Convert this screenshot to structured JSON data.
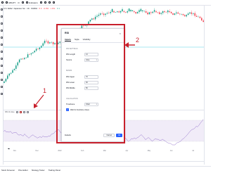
{
  "topbar": {
    "symbol": "GBUPY",
    "interval": "D",
    "indicators_label": "Indicators",
    "icons": [
      "menu-icon",
      "search-icon",
      "chart-type-icon",
      "indicators-icon",
      "alert-icon",
      "replay-icon",
      "undo-icon",
      "redo-icon"
    ]
  },
  "secondbar": {
    "title": "U.S. Dollar / Japanese Yen · 1D · OANDA",
    "o": "O 0.",
    "h": "H 152.",
    "l": "L 151.",
    "c": "C 1"
  },
  "oscillator": {
    "label": "RSI 14 close"
  },
  "time_axis": [
    "Nov",
    "Dec",
    "2022",
    "Feb",
    "Mar",
    "Apr",
    "May",
    "Jun",
    "Jul"
  ],
  "bottom_tabs": [
    "Stock Screener",
    "Pine Editor",
    "Strategy Tester",
    "Trading Panel"
  ],
  "dialog": {
    "title": "RSI",
    "close": "×",
    "tabs": [
      "Inputs",
      "Style",
      "Visibility"
    ],
    "section1": "RSI SETTINGS",
    "rows1": [
      {
        "label": "RSI Length",
        "value": "14"
      },
      {
        "label": "Source",
        "value": "close"
      }
    ],
    "section2": "BANDS",
    "rows2": [
      {
        "label": "RSI Upper",
        "value": "70"
      },
      {
        "label": "RSI Lower",
        "value": "30"
      },
      {
        "label": "RSI Middle",
        "value": "50"
      }
    ],
    "section3": "CALCULATION",
    "rows3": [
      {
        "label": "Timeframe",
        "value": "Chart"
      }
    ],
    "checkbox_label": "Wait for timeframe closes",
    "defaults_label": "Defaults",
    "cancel_label": "Cancel",
    "ok_label": "Ok"
  },
  "callouts": {
    "one": "1",
    "two": "2"
  },
  "colors": {
    "up": "#089981",
    "down": "#f23645",
    "accent": "#2962ff",
    "annotation": "#c8202c",
    "rsi_line": "#7e57c2"
  }
}
